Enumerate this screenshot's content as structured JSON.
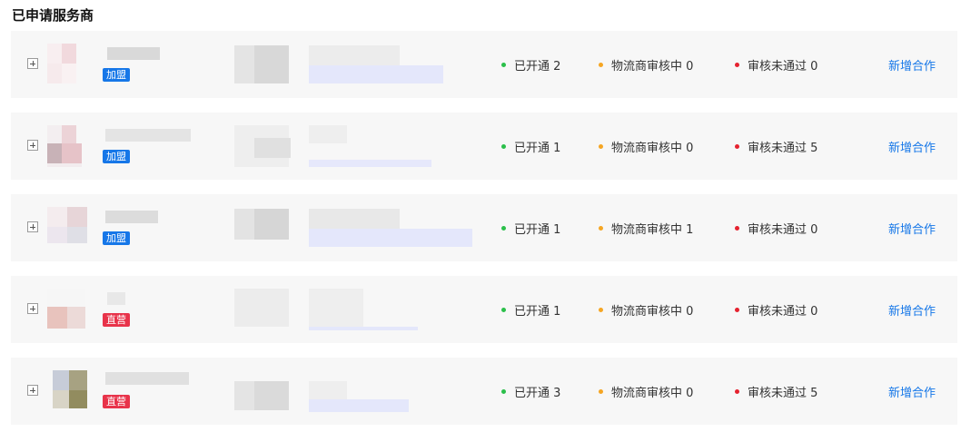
{
  "section_title": "已申请服务商",
  "colors": {
    "green": "#2bbf4a",
    "orange": "#f5a623",
    "red": "#e5222f",
    "link": "#1677e8"
  },
  "rows": [
    {
      "tag": "加盟",
      "tag_color": "blue",
      "opened": "已开通 2",
      "pending": "物流商审核中 0",
      "rejected": "审核未通过 0",
      "action": "新增合作"
    },
    {
      "tag": "加盟",
      "tag_color": "blue",
      "opened": "已开通 1",
      "pending": "物流商审核中 0",
      "rejected": "审核未通过 5",
      "action": "新增合作"
    },
    {
      "tag": "加盟",
      "tag_color": "blue",
      "opened": "已开通 1",
      "pending": "物流商审核中 1",
      "rejected": "审核未通过 0",
      "action": "新增合作"
    },
    {
      "tag": "直营",
      "tag_color": "red",
      "opened": "已开通 1",
      "pending": "物流商审核中 0",
      "rejected": "审核未通过 0",
      "action": "新增合作"
    },
    {
      "tag": "直营",
      "tag_color": "red",
      "opened": "已开通 3",
      "pending": "物流商审核中 0",
      "rejected": "审核未通过 5",
      "action": "新增合作"
    }
  ]
}
